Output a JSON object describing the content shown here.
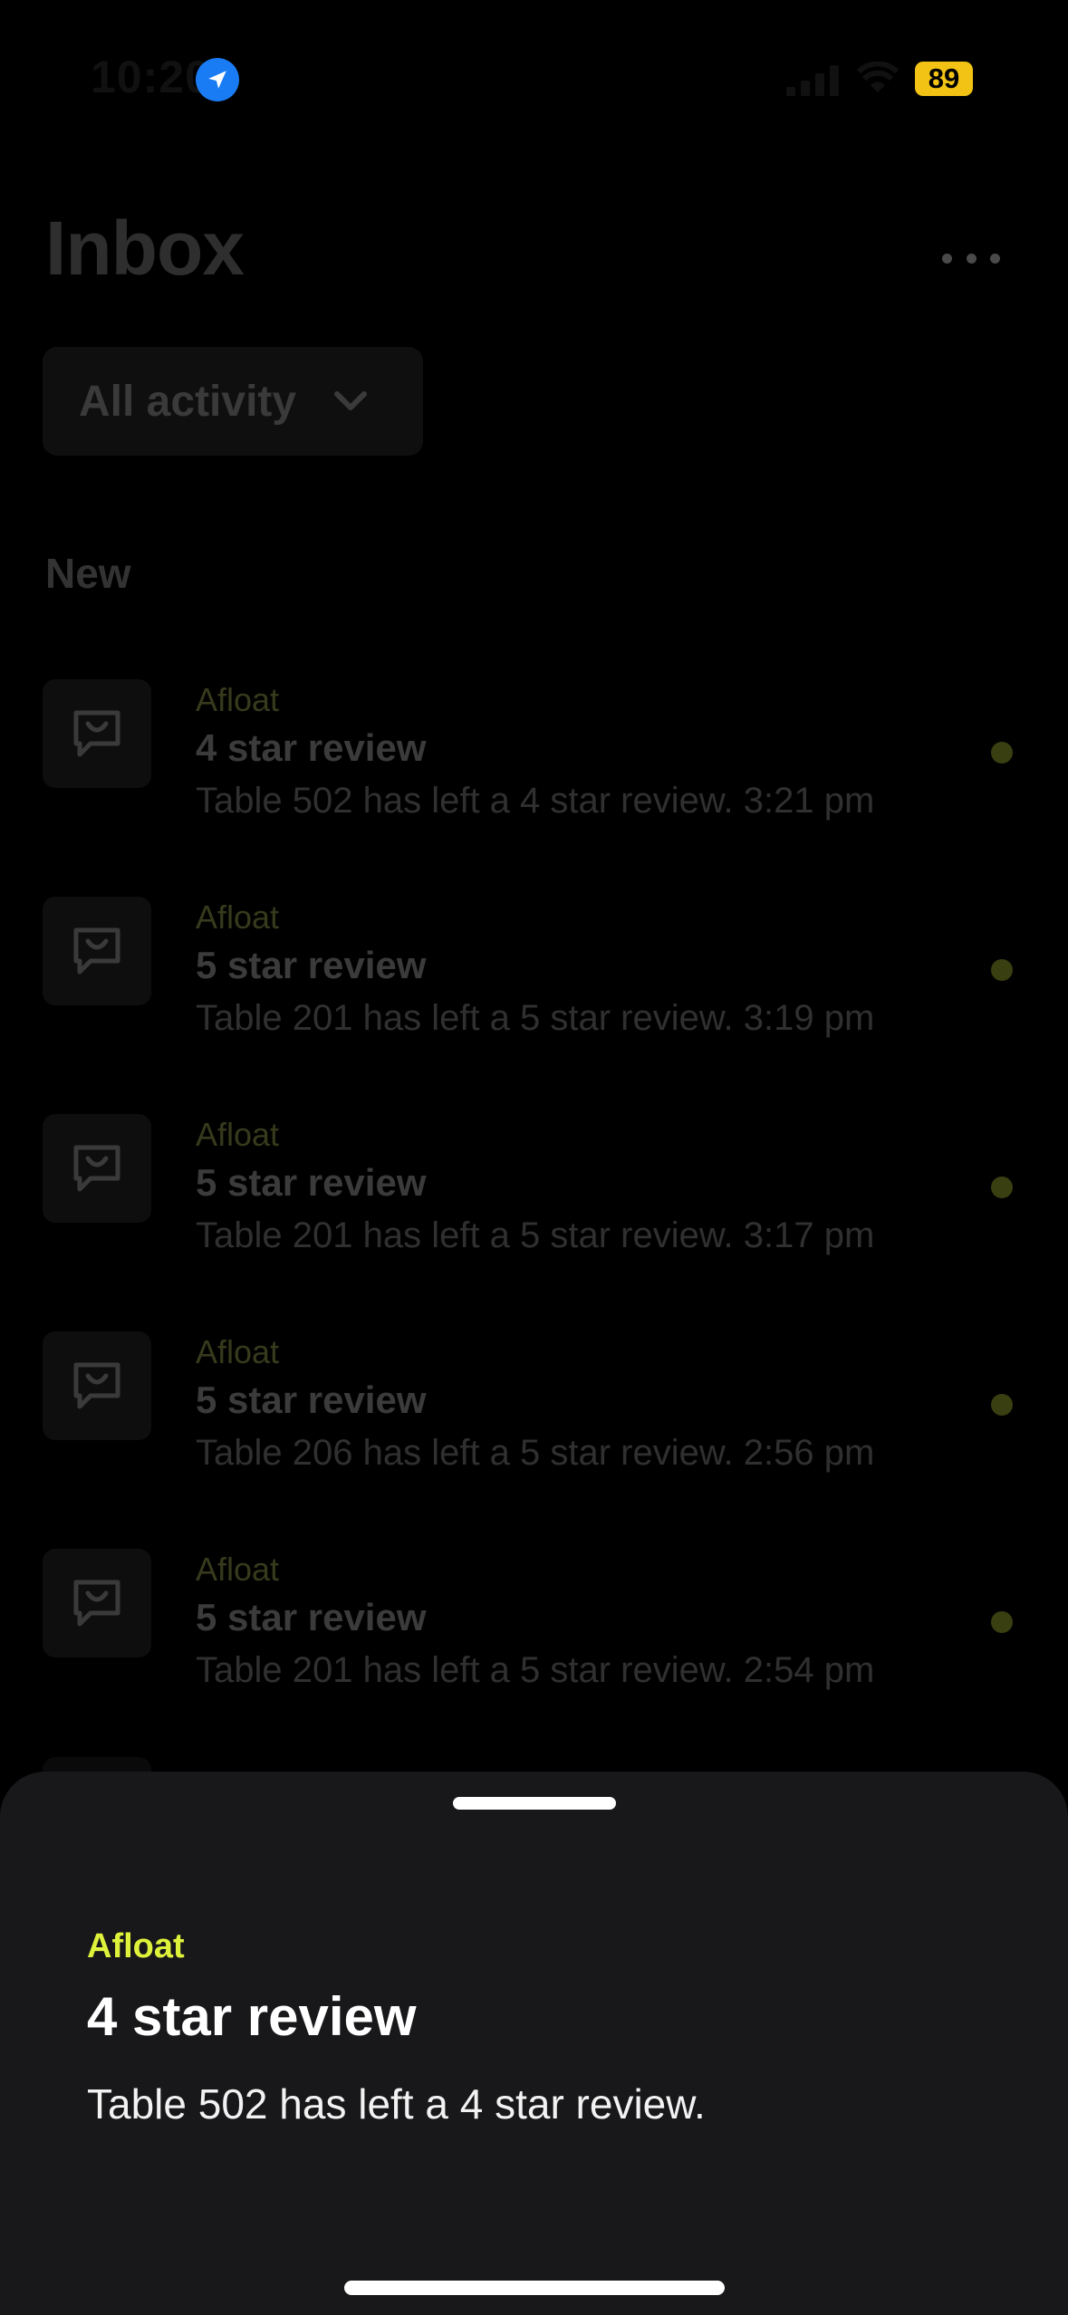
{
  "status_bar": {
    "time": "10:20",
    "battery": "89",
    "icons": [
      "location-arrow-icon",
      "cellular-signal-icon",
      "wifi-icon",
      "battery-icon"
    ],
    "colors": {
      "location": "#1a7cf5",
      "battery": "#f2c314"
    }
  },
  "header": {
    "title": "Inbox",
    "more_icon": "ellipsis-icon"
  },
  "filter": {
    "label": "All activity",
    "icon": "chevron-down-icon"
  },
  "section": {
    "title": "New"
  },
  "inbox": {
    "items": [
      {
        "source": "Afloat",
        "title": "4 star review",
        "body": "Table 502 has left a 4 star review.  3:21 pm",
        "unread": true,
        "icon": "review-chat-icon"
      },
      {
        "source": "Afloat",
        "title": "5 star review",
        "body": "Table 201 has left a 5 star review.  3:19 pm",
        "unread": true,
        "icon": "review-chat-icon"
      },
      {
        "source": "Afloat",
        "title": "5 star review",
        "body": "Table 201 has left a 5 star review.  3:17 pm",
        "unread": true,
        "icon": "review-chat-icon"
      },
      {
        "source": "Afloat",
        "title": "5 star review",
        "body": "Table 206 has left a 5 star review.  2:56 pm",
        "unread": true,
        "icon": "review-chat-icon"
      },
      {
        "source": "Afloat",
        "title": "5 star review",
        "body": "Table 201 has left a 5 star review.  2:54 pm",
        "unread": true,
        "icon": "review-chat-icon"
      }
    ]
  },
  "sheet": {
    "source": "Afloat",
    "title": "4 star review",
    "body": "Table 502 has left a 4 star review.",
    "colors": {
      "accent": "#dff23b",
      "background": "#18181a"
    }
  }
}
